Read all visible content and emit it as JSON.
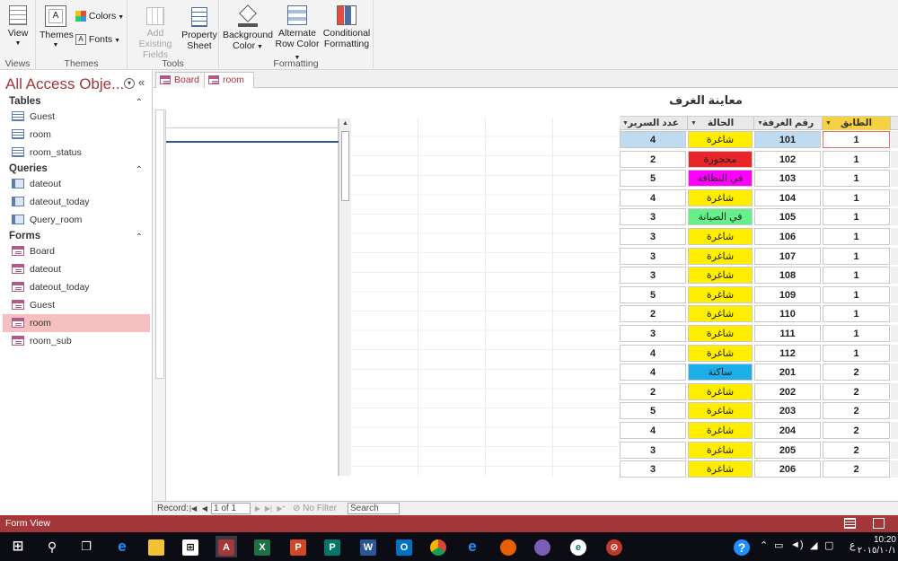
{
  "ribbon": {
    "views": {
      "view_label": "View",
      "group_label": "Views"
    },
    "themes": {
      "themes_label": "Themes",
      "colors_label": "Colors",
      "fonts_label": "Fonts",
      "group_label": "Themes"
    },
    "tools": {
      "add_fields_line1": "Add Existing",
      "add_fields_line2": "Fields",
      "property_line1": "Property",
      "property_line2": "Sheet",
      "group_label": "Tools"
    },
    "formatting": {
      "bg_line1": "Background",
      "bg_line2": "Color",
      "alt_line1": "Alternate",
      "alt_line2": "Row Color",
      "cond_line1": "Conditional",
      "cond_line2": "Formatting",
      "group_label": "Formatting"
    }
  },
  "nav": {
    "title": "All Access Obje...",
    "sections": [
      {
        "label": "Tables",
        "items": [
          "Guest",
          "room",
          "room_status"
        ]
      },
      {
        "label": "Queries",
        "items": [
          "dateout",
          "dateout_today",
          "Query_room"
        ]
      },
      {
        "label": "Forms",
        "items": [
          "Board",
          "dateout",
          "dateout_today",
          "Guest",
          "room",
          "room_sub"
        ]
      }
    ],
    "selected": "room"
  },
  "tabs": [
    {
      "label": "Board"
    },
    {
      "label": "room"
    }
  ],
  "form": {
    "title": "معاينة الغرف",
    "headers": {
      "beds": "عدد السرير",
      "status": "الحالة",
      "room": "رقم الغرفة",
      "floor": "الطابق"
    },
    "rows": [
      {
        "beds": "4",
        "status": "شاغرة",
        "room": "101",
        "floor": "1"
      },
      {
        "beds": "2",
        "status": "محجوزة",
        "room": "102",
        "floor": "1"
      },
      {
        "beds": "5",
        "status": "في النظافة",
        "room": "103",
        "floor": "1"
      },
      {
        "beds": "4",
        "status": "شاغرة",
        "room": "104",
        "floor": "1"
      },
      {
        "beds": "3",
        "status": "في الصيانة",
        "room": "105",
        "floor": "1"
      },
      {
        "beds": "3",
        "status": "شاغرة",
        "room": "106",
        "floor": "1"
      },
      {
        "beds": "3",
        "status": "شاغرة",
        "room": "107",
        "floor": "1"
      },
      {
        "beds": "3",
        "status": "شاغرة",
        "room": "108",
        "floor": "1"
      },
      {
        "beds": "5",
        "status": "شاغرة",
        "room": "109",
        "floor": "1"
      },
      {
        "beds": "2",
        "status": "شاغرة",
        "room": "110",
        "floor": "1"
      },
      {
        "beds": "3",
        "status": "شاغرة",
        "room": "111",
        "floor": "1"
      },
      {
        "beds": "4",
        "status": "شاغرة",
        "room": "112",
        "floor": "1"
      },
      {
        "beds": "4",
        "status": "ساكنة",
        "room": "201",
        "floor": "2"
      },
      {
        "beds": "2",
        "status": "شاغرة",
        "room": "202",
        "floor": "2"
      },
      {
        "beds": "5",
        "status": "شاغرة",
        "room": "203",
        "floor": "2"
      },
      {
        "beds": "4",
        "status": "شاغرة",
        "room": "204",
        "floor": "2"
      },
      {
        "beds": "3",
        "status": "شاغرة",
        "room": "205",
        "floor": "2"
      },
      {
        "beds": "3",
        "status": "شاغرة",
        "room": "206",
        "floor": "2"
      }
    ],
    "status_colors": {
      "شاغرة": "#ffee00",
      "محجوزة": "#e8262a",
      "في النظافة": "#ff00ff",
      "في الصيانة": "#66f08a",
      "ساكنة": "#1eaeea"
    }
  },
  "record_nav": {
    "label": "Record:",
    "value": "1 of 1",
    "filter_label": "No Filter",
    "search_placeholder": "Search"
  },
  "status_bar": {
    "text": "Form View"
  },
  "taskbar": {
    "time": "10:20",
    "date": "٢٠١٥/١٠/١",
    "lang": "ع"
  }
}
